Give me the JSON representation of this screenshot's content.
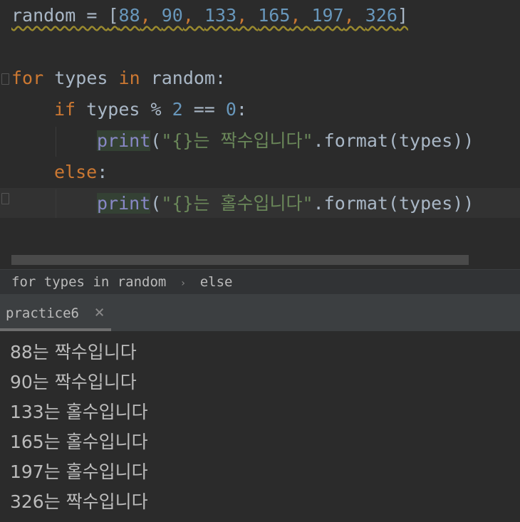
{
  "editor": {
    "line1": {
      "var": "random",
      "op": " = ",
      "open": "[",
      "nums": [
        "88",
        "90",
        "133",
        "165",
        "197",
        "326"
      ],
      "close": "]"
    },
    "line3": {
      "kw_for": "for",
      "var": " types ",
      "kw_in": "in",
      "rest": " random:"
    },
    "line4": {
      "kw_if": "if",
      "var": " types % ",
      "n2": "2",
      "eq": " == ",
      "n0": "0",
      "colon": ":"
    },
    "line5": {
      "builtin": "print",
      "open": "(",
      "str": "\"{}는 짝수입니다\"",
      "rest": ".format(types))"
    },
    "line6": {
      "kw_else": "else",
      "colon": ":"
    },
    "line7": {
      "builtin": "print",
      "open": "(",
      "str": "\"{}는 홀수입니다\"",
      "rest": ".format(types))"
    }
  },
  "breadcrumb": {
    "item1": "for types in random",
    "sep": "›",
    "item2": "else"
  },
  "run_tab": {
    "label": "practice6",
    "close": "×"
  },
  "output": {
    "lines": [
      "88는 짝수입니다",
      "90는 짝수입니다",
      "133는 홀수입니다",
      "165는 홀수입니다",
      "197는 홀수입니다",
      "326는 짝수입니다"
    ]
  },
  "colors": {
    "keyword": "#cc7832",
    "number": "#6897bb",
    "string": "#6a8759",
    "builtin": "#8888c6",
    "background": "#2b2b2b"
  }
}
